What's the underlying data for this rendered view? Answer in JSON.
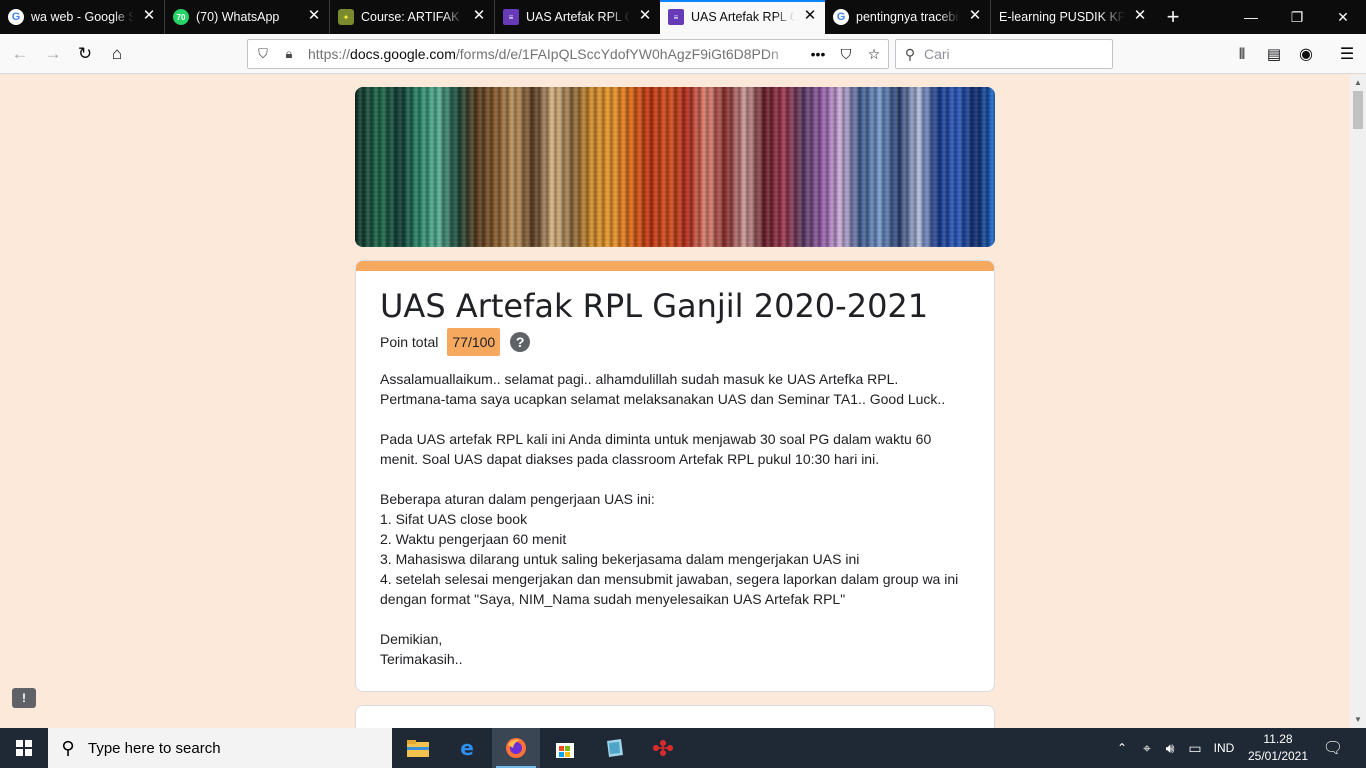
{
  "browser": {
    "tabs": [
      {
        "title": "wa web - Google Se",
        "favicon": "google-icon",
        "active": false
      },
      {
        "title": "(70) WhatsApp",
        "favicon": "whatsapp-icon",
        "active": false
      },
      {
        "title": "Course: ARTIFAK RE",
        "favicon": "moodle-icon",
        "active": false
      },
      {
        "title": "UAS Artefak RPL Ga",
        "favicon": "google-forms-icon",
        "active": false
      },
      {
        "title": "UAS Artefak RPL Ga",
        "favicon": "google-forms-icon",
        "active": true
      },
      {
        "title": "pentingnya tracebili",
        "favicon": "google-icon",
        "active": false
      },
      {
        "title": "E-learning PUSDIK KP",
        "favicon": "none",
        "active": false
      }
    ],
    "whatsapp_badge": "70",
    "url_prefix": "https://",
    "url_host": "docs.google.com",
    "url_path": "/forms/d/e/1FAIpQLSccYdofYW0hAgzF9iGt6D8PDn",
    "search_placeholder": "Cari",
    "accent_color": "#0a84ff"
  },
  "form": {
    "title": "UAS Artefak RPL Ganjil 2020-2021",
    "score_label": "Poin total",
    "score_value": "77/100",
    "help_symbol": "?",
    "description": "Assalamuallaikum.. selamat pagi.. alhamdulillah sudah masuk ke UAS Artefka RPL.\nPertmana-tama saya ucapkan selamat melaksanakan UAS dan Seminar TA1.. Good Luck..\n\nPada UAS artefak RPL kali ini Anda diminta untuk menjawab 30 soal PG dalam waktu 60 menit. Soal UAS dapat diakses pada classroom Artefak RPL pukul 10:30 hari ini.\n\nBeberapa aturan dalam pengerjaan UAS ini:\n1. Sifat UAS close book\n2. Waktu pengerjaan 60 menit\n3. Mahasiswa dilarang untuk saling bekerjasama dalam mengerjakan UAS ini\n4. setelah selesai mengerjakan dan mensubmit jawaban, segera laporkan dalam group wa ini dengan format \"Saya, NIM_Nama sudah menyelesaikan UAS Artefak RPL\"\n\nDemikian,\nTerimakasih..",
    "theme_color": "#f6a95e",
    "background_color": "#fde9da",
    "feedback_symbol": "!"
  },
  "taskbar": {
    "search_placeholder": "Type here to search",
    "apps": [
      "file-explorer-icon",
      "edge-icon",
      "firefox-icon",
      "store-icon",
      "app-icon",
      "network-app-icon"
    ],
    "language": "IND",
    "time": "11.28",
    "date": "25/01/2021"
  }
}
